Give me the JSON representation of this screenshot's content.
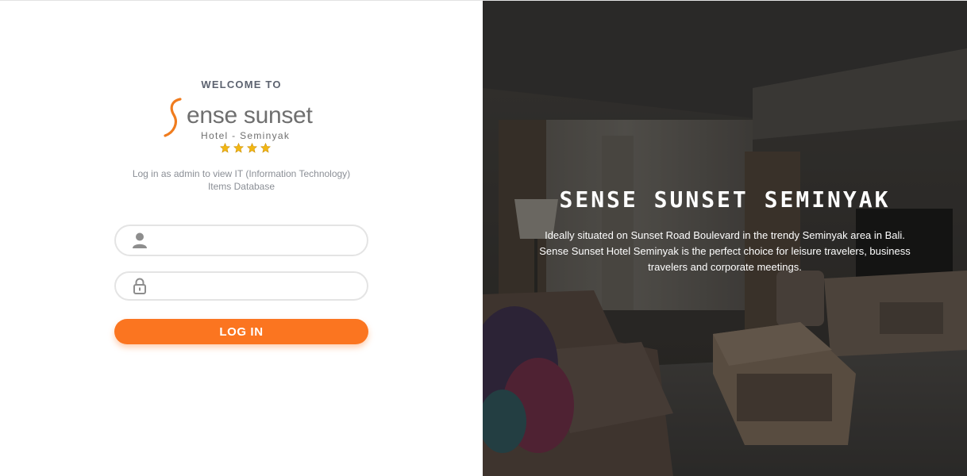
{
  "login": {
    "welcome": "WELCOME TO",
    "logo": {
      "name": "ense sunset",
      "subtitle": "Hotel - Seminyak",
      "stars": 4
    },
    "tagline": "Log in as admin to view IT (Information Technology) Items Database",
    "username_placeholder": "",
    "password_placeholder": "",
    "button_label": "LOG IN",
    "accent_color": "#fb7520"
  },
  "hero": {
    "title": "SENSE SUNSET SEMINYAK",
    "description": "Ideally situated on Sunset Road Boulevard in the trendy Seminyak area in Bali. Sense Sunset Hotel Seminyak is the perfect choice for leisure travelers, business travelers and corporate meetings."
  },
  "icons": {
    "username": "user-icon",
    "password": "lock-icon",
    "rating": "star-icon"
  }
}
